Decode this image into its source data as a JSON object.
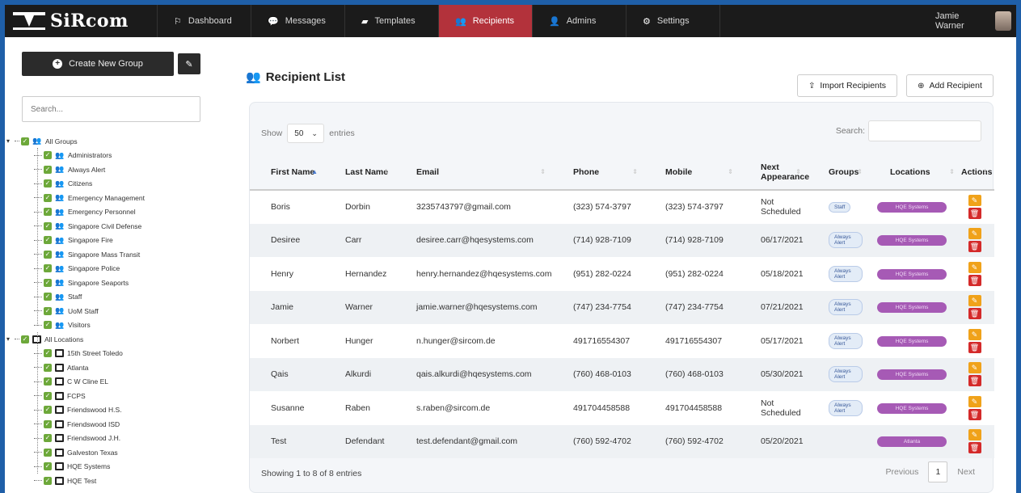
{
  "brand": {
    "name": "SiRcom"
  },
  "nav": [
    {
      "label": "Dashboard",
      "icon": "bullhorn-icon",
      "glyph": "⚐"
    },
    {
      "label": "Messages",
      "icon": "comment-icon",
      "glyph": "💬"
    },
    {
      "label": "Templates",
      "icon": "book-icon",
      "glyph": "▰"
    },
    {
      "label": "Recipients",
      "icon": "users-icon",
      "glyph": "👥",
      "active": true
    },
    {
      "label": "Admins",
      "icon": "user-icon",
      "glyph": "👤"
    },
    {
      "label": "Settings",
      "icon": "gear-icon",
      "glyph": "⚙"
    }
  ],
  "user": {
    "name": "Jamie Warner"
  },
  "sidebar": {
    "create_label": "Create New Group",
    "search_placeholder": "Search...",
    "groups_root": "All Groups",
    "groups": [
      "Administrators",
      "Always Alert",
      "Citizens",
      "Emergency Management",
      "Emergency Personnel",
      "Singapore Civil Defense",
      "Singapore Fire",
      "Singapore Mass Transit",
      "Singapore Police",
      "Singapore Seaports",
      "Staff",
      "UoM Staff",
      "Visitors"
    ],
    "locations_root": "All Locations",
    "locations": [
      "15th Street Toledo",
      "Atlanta",
      "C W Cline EL",
      "FCPS",
      "Friendswood H.S.",
      "Friendswood ISD",
      "Friendswood J.H.",
      "Galveston Texas",
      "HQE Systems",
      "HQE Test"
    ]
  },
  "main": {
    "title": "Recipient List",
    "import_label": "Import Recipients",
    "add_label": "Add Recipient",
    "show_label": "Show",
    "show_value": "50",
    "entries_label": "entries",
    "search_label": "Search:",
    "columns": [
      "First Name",
      "Last Name",
      "Email",
      "Phone",
      "Mobile",
      "Next Appearance",
      "Groups",
      "Locations",
      "Actions"
    ],
    "rows": [
      {
        "first": "Boris",
        "last": "Dorbin",
        "email": "3235743797@gmail.com",
        "phone": "(323) 574-3797",
        "mobile": "(323) 574-3797",
        "next": "Not Scheduled",
        "group": "Staff",
        "location": "HQE Systems"
      },
      {
        "first": "Desiree",
        "last": "Carr",
        "email": "desiree.carr@hqesystems.com",
        "phone": "(714) 928-7109",
        "mobile": "(714) 928-7109",
        "next": "06/17/2021",
        "group": "Always Alert",
        "location": "HQE Systems"
      },
      {
        "first": "Henry",
        "last": "Hernandez",
        "email": "henry.hernandez@hqesystems.com",
        "phone": "(951) 282-0224",
        "mobile": "(951) 282-0224",
        "next": "05/18/2021",
        "group": "Always Alert",
        "location": "HQE Systems"
      },
      {
        "first": "Jamie",
        "last": "Warner",
        "email": "jamie.warner@hqesystems.com",
        "phone": "(747) 234-7754",
        "mobile": "(747) 234-7754",
        "next": "07/21/2021",
        "group": "Always Alert",
        "location": "HQE Systems"
      },
      {
        "first": "Norbert",
        "last": "Hunger",
        "email": "n.hunger@sircom.de",
        "phone": "491716554307",
        "mobile": "491716554307",
        "next": "05/17/2021",
        "group": "Always Alert",
        "location": "HQE Systems"
      },
      {
        "first": "Qais",
        "last": "Alkurdi",
        "email": "qais.alkurdi@hqesystems.com",
        "phone": "(760) 468-0103",
        "mobile": "(760) 468-0103",
        "next": "05/30/2021",
        "group": "Always Alert",
        "location": "HQE Systems"
      },
      {
        "first": "Susanne",
        "last": "Raben",
        "email": "s.raben@sircom.de",
        "phone": "491704458588",
        "mobile": "491704458588",
        "next": "Not Scheduled",
        "group": "Always Alert",
        "location": "HQE Systems"
      },
      {
        "first": "Test",
        "last": "Defendant",
        "email": "test.defendant@gmail.com",
        "phone": "(760) 592-4702",
        "mobile": "(760) 592-4702",
        "next": "05/20/2021",
        "group": "",
        "location": "Atlanta"
      }
    ],
    "info": "Showing 1 to 8 of 8 entries",
    "prev_label": "Previous",
    "page": "1",
    "next_label": "Next"
  },
  "colors": {
    "active_nav": "#b3323b",
    "tree_check": "#6da83a",
    "location_pill": "#a65ab5",
    "edit": "#f0a21a",
    "delete": "#d42a2a"
  }
}
